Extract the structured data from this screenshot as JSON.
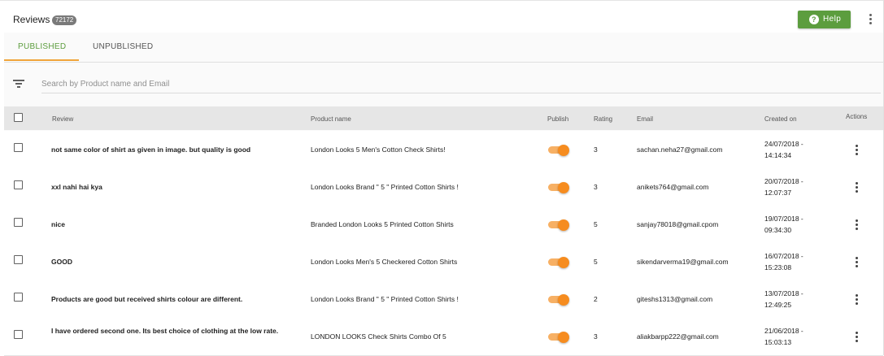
{
  "header": {
    "title": "Reviews",
    "count": "72172",
    "help_label": "Help"
  },
  "tabs": [
    {
      "label": "PUBLISHED",
      "active": true
    },
    {
      "label": "UNPUBLISHED",
      "active": false
    }
  ],
  "search": {
    "placeholder": "Search by Product name and Email",
    "value": ""
  },
  "table": {
    "headers": {
      "review": "Review",
      "product": "Product name",
      "publish": "Publish",
      "rating": "Rating",
      "email": "Email",
      "created": "Created on",
      "actions": "Actions"
    },
    "rows": [
      {
        "review": "not same color of shirt as given in image. but quality is good",
        "product": "London Looks 5 Men's Cotton Check Shirts!",
        "published": true,
        "rating": "3",
        "email": "sachan.neha27@gmail.com",
        "date": "24/07/2018 -",
        "time": "14:14:34"
      },
      {
        "review": "xxl nahi hai kya",
        "product": "London Looks Brand \" 5 \" Printed Cotton Shirts !",
        "published": true,
        "rating": "3",
        "email": "anikets764@gmail.com",
        "date": "20/07/2018 -",
        "time": "12:07:37"
      },
      {
        "review": "nice",
        "product": "Branded London Looks 5 Printed Cotton Shirts",
        "published": true,
        "rating": "5",
        "email": "sanjay78018@gmail.cpom",
        "date": "19/07/2018 -",
        "time": "09:34:30"
      },
      {
        "review": "GOOD",
        "product": "London Looks Men's 5 Checkered Cotton Shirts",
        "published": true,
        "rating": "5",
        "email": "sikendarverma19@gmail.com",
        "date": "16/07/2018 -",
        "time": "15:23:08"
      },
      {
        "review": "Products are good but received shirts colour are different.",
        "product": "London Looks Brand \" 5 \" Printed Cotton Shirts !",
        "published": true,
        "rating": "2",
        "email": "giteshs1313@gmail.com",
        "date": "13/07/2018 -",
        "time": "12:49:25"
      },
      {
        "review": "I have ordered second one. Its best choice of clothing at the low rate.",
        "product": "LONDON LOOKS Check Shirts Combo Of 5",
        "published": true,
        "rating": "3",
        "email": "aliakbarpp222@gmail.com",
        "date": "21/06/2018 -",
        "time": "15:03:13"
      }
    ]
  },
  "colors": {
    "accent_green": "#5c9d3e",
    "tab_underline": "#f0a43a",
    "toggle_on": "#f68c1f"
  },
  "icons": [
    "help-icon",
    "more-vert-icon",
    "filter-icon",
    "checkbox-icon"
  ]
}
